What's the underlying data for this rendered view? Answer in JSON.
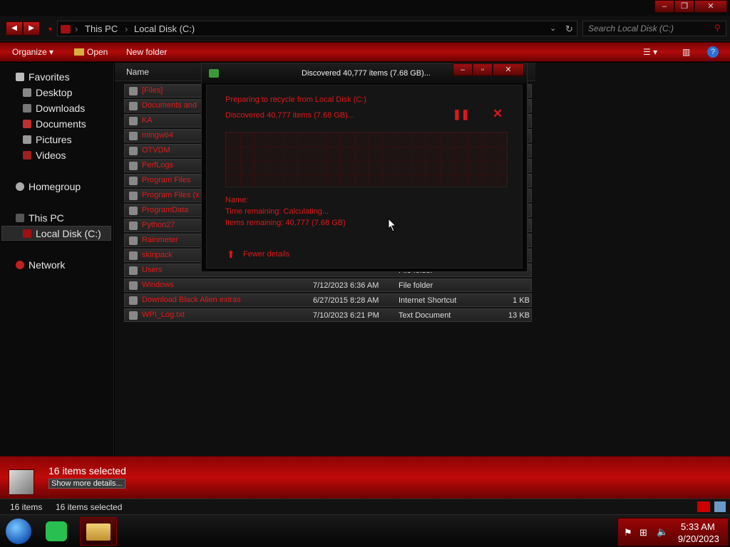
{
  "window": {
    "controls": [
      "minimize",
      "maximize",
      "close"
    ]
  },
  "address": {
    "crumbs": [
      "This PC",
      "Local Disk (C:)"
    ],
    "search_placeholder": "Search Local Disk (C:)"
  },
  "toolbar": {
    "organize": "Organize",
    "open": "Open",
    "new_folder": "New folder"
  },
  "nav": {
    "favorites": "Favorites",
    "desktop": "Desktop",
    "downloads": "Downloads",
    "documents": "Documents",
    "pictures": "Pictures",
    "videos": "Videos",
    "homegroup": "Homegroup",
    "this_pc": "This PC",
    "local_disk": "Local Disk (C:)",
    "network": "Network"
  },
  "files": {
    "column_name": "Name",
    "rows": [
      {
        "name": "[Files]",
        "date": "",
        "type": "",
        "size": ""
      },
      {
        "name": "Documents and",
        "date": "",
        "type": "",
        "size": ""
      },
      {
        "name": "KA",
        "date": "",
        "type": "",
        "size": ""
      },
      {
        "name": "mingw64",
        "date": "",
        "type": "",
        "size": ""
      },
      {
        "name": "OTVDM",
        "date": "",
        "type": "",
        "size": ""
      },
      {
        "name": "PerfLogs",
        "date": "",
        "type": "",
        "size": ""
      },
      {
        "name": "Program Files",
        "date": "",
        "type": "",
        "size": ""
      },
      {
        "name": "Program Files (x",
        "date": "",
        "type": "",
        "size": ""
      },
      {
        "name": "ProgramData",
        "date": "",
        "type": "",
        "size": ""
      },
      {
        "name": "Python27",
        "date": "",
        "type": "",
        "size": ""
      },
      {
        "name": "Rainmeter",
        "date": "",
        "type": "",
        "size": ""
      },
      {
        "name": "skinpack",
        "date": "",
        "type": "",
        "size": ""
      },
      {
        "name": "Users",
        "date": "",
        "type": "File folder",
        "size": ""
      },
      {
        "name": "Windows",
        "date": "7/12/2023 6:36 AM",
        "type": "File folder",
        "size": ""
      },
      {
        "name": "Download Black Alien extras",
        "date": "6/27/2015 8:28 AM",
        "type": "Internet Shortcut",
        "size": "1 KB"
      },
      {
        "name": "WPI_Log.txt",
        "date": "7/10/2023 6:21 PM",
        "type": "Text Document",
        "size": "13 KB"
      }
    ]
  },
  "dialog": {
    "title": "Discovered 40,777 items (7.68 GB)...",
    "preparing": "Preparing to recycle from Local Disk (C:)",
    "discovered": "Discovered 40,777 items (7.68 GB)...",
    "name_label": "Name:",
    "time_remaining": "Time remaining: Calculating...",
    "items_remaining": "Items remaining: 40,777 (7.68 GB)",
    "fewer_details": "Fewer details",
    "pause_icon": "pause-icon",
    "cancel_icon": "close-icon"
  },
  "details": {
    "selected": "16 items selected",
    "show_more": "Show more details..."
  },
  "status": {
    "count": "16 items",
    "selected": "16 items selected"
  },
  "clock": {
    "time": "5:33 AM",
    "date": "9/20/2023"
  },
  "colors": {
    "accent": "#c00a0a",
    "file_text": "#e01a1a",
    "background": "#0f0f0f"
  }
}
